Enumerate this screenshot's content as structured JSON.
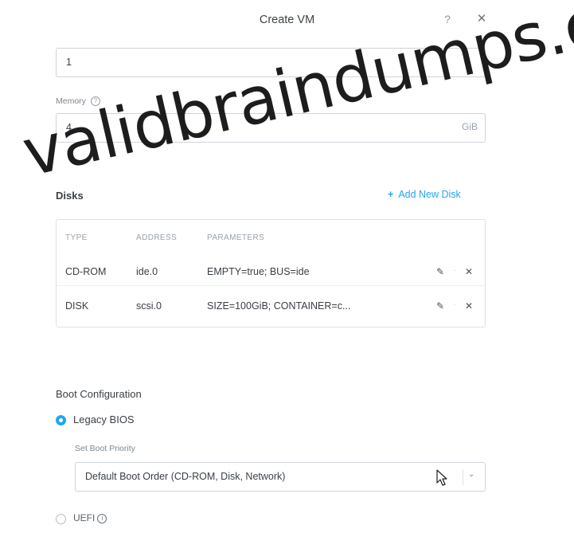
{
  "dialog": {
    "title": "Create VM",
    "help_glyph": "?",
    "close_glyph": "✕"
  },
  "vcpus": {
    "value": "1"
  },
  "memory": {
    "label": "Memory",
    "info_glyph": "?",
    "value": "4",
    "unit": "GiB"
  },
  "disks": {
    "heading": "Disks",
    "add_label": "Add New Disk",
    "add_glyph": "+",
    "columns": [
      "TYPE",
      "ADDRESS",
      "PARAMETERS"
    ],
    "rows": [
      {
        "type": "CD-ROM",
        "address": "ide.0",
        "parameters": "EMPTY=true; BUS=ide"
      },
      {
        "type": "DISK",
        "address": "scsi.0",
        "parameters": "SIZE=100GiB; CONTAINER=c..."
      }
    ],
    "edit_glyph": "✎",
    "delete_glyph": "✕",
    "separator_glyph": "·"
  },
  "boot": {
    "heading": "Boot Configuration",
    "legacy_label": "Legacy BIOS",
    "legacy_selected": true,
    "priority_label": "Set Boot Priority",
    "priority_value": "Default Boot Order (CD-ROM, Disk, Network)",
    "chevron_glyph": "⌄",
    "uefi_label": "UEFI",
    "uefi_info_glyph": "i",
    "uefi_selected": false
  },
  "watermark": {
    "text": "validbraindumps.co"
  },
  "colors": {
    "accent": "#22a5f0",
    "text": "#3a3f45",
    "muted": "#9aa1a8",
    "border": "#cfd4d9"
  }
}
